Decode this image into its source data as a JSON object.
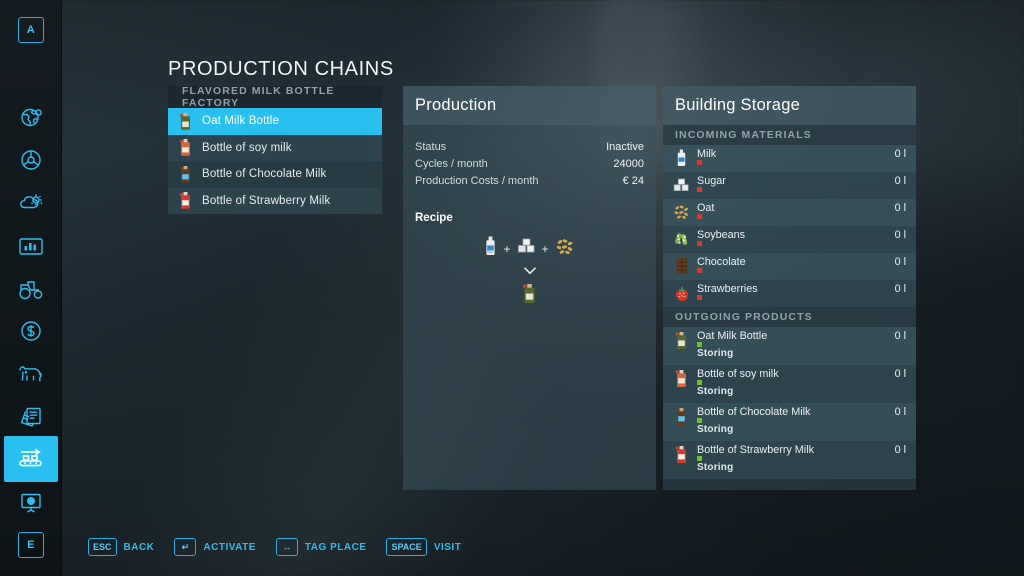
{
  "sidebar": {
    "top_key": "A",
    "bottom_key": "E",
    "items": [
      {
        "name": "map-icon",
        "label": "Map"
      },
      {
        "name": "vehicle-icon",
        "label": "Steering"
      },
      {
        "name": "weather-icon",
        "label": "Weather"
      },
      {
        "name": "statistics-icon",
        "label": "Statistics"
      },
      {
        "name": "tractor-icon",
        "label": "Vehicles"
      },
      {
        "name": "finances-icon",
        "label": "Finances"
      },
      {
        "name": "animals-icon",
        "label": "Animals"
      },
      {
        "name": "contracts-icon",
        "label": "Contracts"
      },
      {
        "name": "production-icon",
        "label": "Production"
      },
      {
        "name": "info-icon",
        "label": "Info"
      }
    ]
  },
  "page": {
    "title": "PRODUCTION CHAINS"
  },
  "chains": {
    "list_title": "FLAVORED MILK BOTTLE FACTORY",
    "items": [
      {
        "label": "Oat Milk Bottle",
        "icon": "oat-milk-bottle-icon",
        "selected": true
      },
      {
        "label": "Bottle of soy milk",
        "icon": "soy-milk-bottle-icon",
        "selected": false
      },
      {
        "label": "Bottle of Chocolate Milk",
        "icon": "chocolate-milk-bottle-icon",
        "selected": false
      },
      {
        "label": "Bottle of Strawberry Milk",
        "icon": "strawberry-milk-bottle-icon",
        "selected": false
      }
    ]
  },
  "production": {
    "title": "Production",
    "stats": [
      {
        "label": "Status",
        "value": "Inactive"
      },
      {
        "label": "Cycles / month",
        "value": "24000"
      },
      {
        "label": "Production Costs / month",
        "value": "€ 24"
      }
    ],
    "recipe_title": "Recipe",
    "recipe": {
      "inputs": [
        {
          "icon": "milk-icon",
          "label": "Milk"
        },
        {
          "icon": "sugar-icon",
          "label": "Sugar"
        },
        {
          "icon": "oat-icon",
          "label": "Oat"
        }
      ],
      "plus": "+",
      "arrow": "chevron-down-icon",
      "output": {
        "icon": "oat-milk-bottle-icon",
        "label": "Oat Milk Bottle"
      }
    }
  },
  "storage": {
    "title": "Building Storage",
    "incoming_title": "INCOMING MATERIALS",
    "outgoing_title": "OUTGOING PRODUCTS",
    "incoming": [
      {
        "label": "Milk",
        "amount": "0 l",
        "icon": "milk-icon",
        "fill": 0
      },
      {
        "label": "Sugar",
        "amount": "0 l",
        "icon": "sugar-icon",
        "fill": 0
      },
      {
        "label": "Oat",
        "amount": "0 l",
        "icon": "oat-icon",
        "fill": 0
      },
      {
        "label": "Soybeans",
        "amount": "0 l",
        "icon": "soybeans-icon",
        "fill": 0
      },
      {
        "label": "Chocolate",
        "amount": "0 l",
        "icon": "chocolate-icon",
        "fill": 0
      },
      {
        "label": "Strawberries",
        "amount": "0 l",
        "icon": "strawberries-icon",
        "fill": 0
      }
    ],
    "outgoing": [
      {
        "label": "Oat Milk Bottle",
        "amount": "0 l",
        "status": "Storing",
        "icon": "oat-milk-bottle-icon",
        "fill": 0
      },
      {
        "label": "Bottle of soy milk",
        "amount": "0 l",
        "status": "Storing",
        "icon": "soy-milk-bottle-icon",
        "fill": 0
      },
      {
        "label": "Bottle of Chocolate Milk",
        "amount": "0 l",
        "status": "Storing",
        "icon": "chocolate-milk-bottle-icon",
        "fill": 0
      },
      {
        "label": "Bottle of Strawberry Milk",
        "amount": "0 l",
        "status": "Storing",
        "icon": "strawberry-milk-bottle-icon",
        "fill": 0
      }
    ]
  },
  "helpbar": [
    {
      "key": "ESC",
      "label": "BACK"
    },
    {
      "key": "↵",
      "label": "ACTIVATE"
    },
    {
      "key": "↔",
      "label": "TAG PLACE"
    },
    {
      "key": "SPACE",
      "label": "VISIT"
    }
  ],
  "colors": {
    "accent": "#29c0ef",
    "panel": "#36505a",
    "text": "#e9f0f3",
    "marker_empty": "#e0352b",
    "marker_ok": "#6dc12a"
  }
}
